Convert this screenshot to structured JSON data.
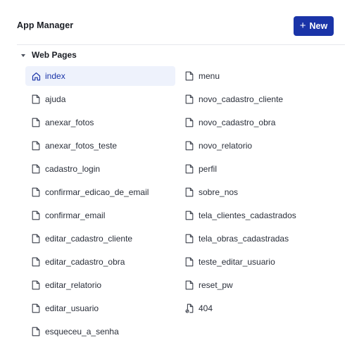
{
  "header": {
    "title": "App Manager",
    "new_button": {
      "icon": "plus-icon",
      "label": "New",
      "color": "#1a34a8"
    }
  },
  "section": {
    "icon": "caret-down-icon",
    "label": "Web Pages",
    "expanded": true
  },
  "pages": {
    "left": [
      {
        "label": "index",
        "icon": "home-icon",
        "active": true
      },
      {
        "label": "ajuda",
        "icon": "page-icon"
      },
      {
        "label": "anexar_fotos",
        "icon": "page-icon"
      },
      {
        "label": "anexar_fotos_teste",
        "icon": "page-icon"
      },
      {
        "label": "cadastro_login",
        "icon": "page-icon"
      },
      {
        "label": "confirmar_edicao_de_email",
        "icon": "page-icon"
      },
      {
        "label": "confirmar_email",
        "icon": "page-icon"
      },
      {
        "label": "editar_cadastro_cliente",
        "icon": "page-icon"
      },
      {
        "label": "editar_cadastro_obra",
        "icon": "page-icon"
      },
      {
        "label": "editar_relatorio",
        "icon": "page-icon"
      },
      {
        "label": "editar_usuario",
        "icon": "page-icon"
      },
      {
        "label": "esqueceu_a_senha",
        "icon": "page-icon"
      }
    ],
    "right": [
      {
        "label": "menu",
        "icon": "page-icon"
      },
      {
        "label": "novo_cadastro_cliente",
        "icon": "page-icon"
      },
      {
        "label": "novo_cadastro_obra",
        "icon": "page-icon"
      },
      {
        "label": "novo_relatorio",
        "icon": "page-icon"
      },
      {
        "label": "perfil",
        "icon": "page-icon"
      },
      {
        "label": "sobre_nos",
        "icon": "page-icon"
      },
      {
        "label": "tela_clientes_cadastrados",
        "icon": "page-icon"
      },
      {
        "label": "tela_obras_cadastradas",
        "icon": "page-icon"
      },
      {
        "label": "teste_editar_usuario",
        "icon": "page-icon"
      },
      {
        "label": "reset_pw",
        "icon": "page-icon"
      },
      {
        "label": "404",
        "icon": "page-not-found-icon"
      }
    ]
  }
}
